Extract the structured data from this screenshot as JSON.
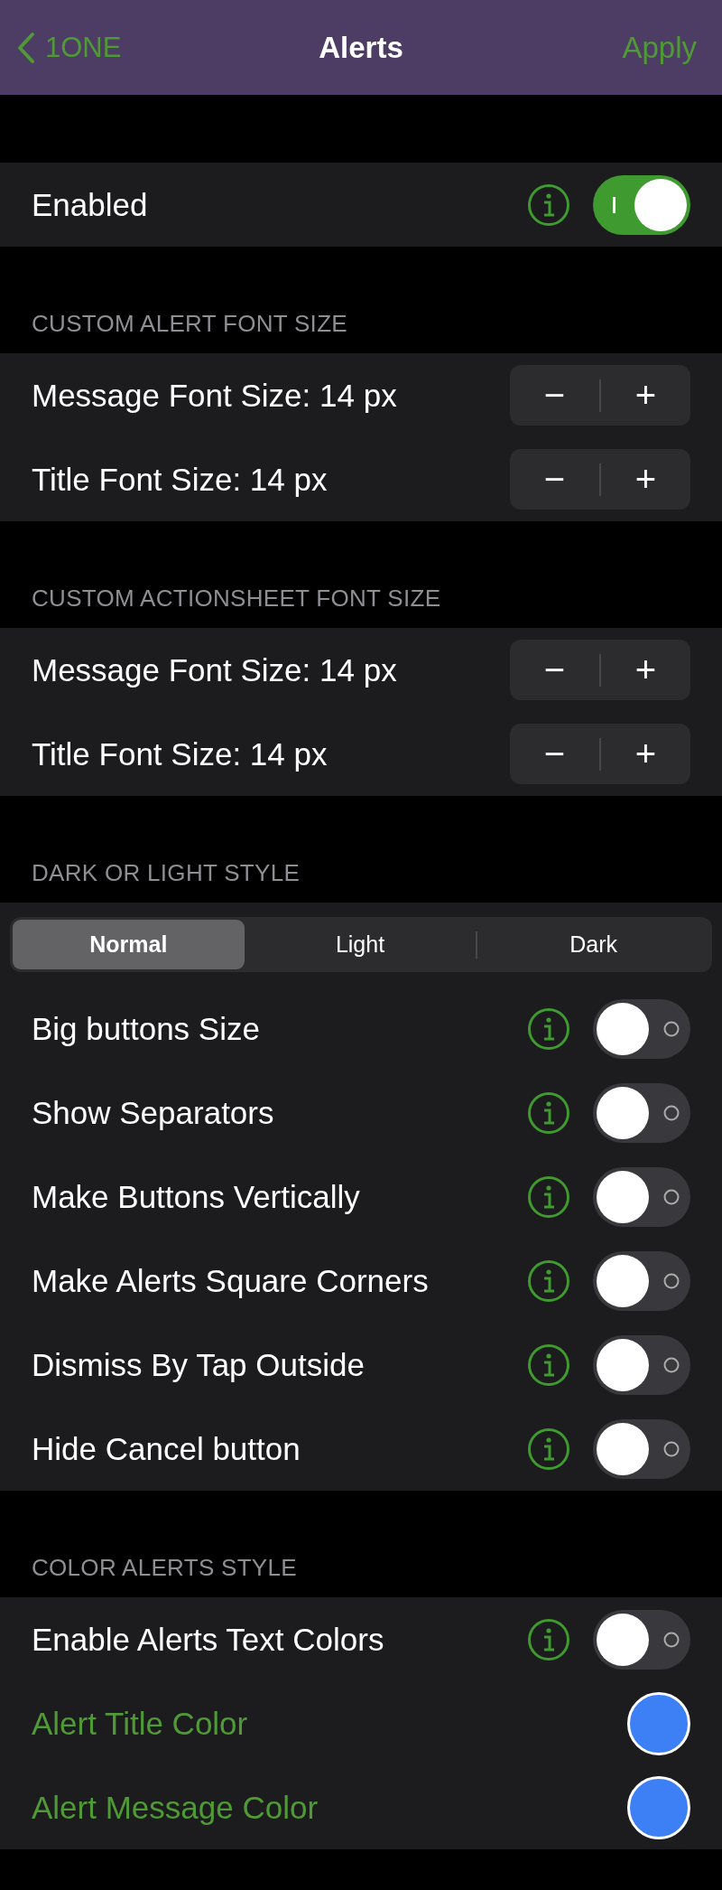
{
  "nav": {
    "back_label": "1ONE",
    "title": "Alerts",
    "action": "Apply"
  },
  "sections": [
    {
      "rows": [
        {
          "kind": "toggle",
          "label": "Enabled",
          "on": true
        }
      ]
    },
    {
      "header": "CUSTOM ALERT FONT SIZE",
      "rows": [
        {
          "kind": "stepper",
          "label": "Message Font Size: 14 px",
          "minus": "−",
          "plus": "+"
        },
        {
          "kind": "stepper",
          "label": "Title Font Size: 14 px",
          "minus": "−",
          "plus": "+"
        }
      ]
    },
    {
      "header": "CUSTOM ACTIONSHEET FONT SIZE",
      "rows": [
        {
          "kind": "stepper",
          "label": "Message Font Size: 14 px",
          "minus": "−",
          "plus": "+"
        },
        {
          "kind": "stepper",
          "label": "Title Font Size: 14 px",
          "minus": "−",
          "plus": "+"
        }
      ]
    },
    {
      "header": "DARK OR LIGHT STYLE",
      "rows": [
        {
          "kind": "segmented",
          "segments": [
            {
              "label": "Normal",
              "selected": true
            },
            {
              "label": "Light",
              "selected": false
            },
            {
              "label": "Dark",
              "selected": false
            }
          ]
        },
        {
          "kind": "toggle",
          "label": "Big buttons Size",
          "on": false
        },
        {
          "kind": "toggle",
          "label": "Show Separators",
          "on": false
        },
        {
          "kind": "toggle",
          "label": "Make Buttons Vertically",
          "on": false
        },
        {
          "kind": "toggle",
          "label": "Make Alerts Square Corners",
          "on": false
        },
        {
          "kind": "toggle",
          "label": "Dismiss By Tap Outside",
          "on": false
        },
        {
          "kind": "toggle",
          "label": "Hide Cancel button",
          "on": false
        }
      ]
    },
    {
      "header": "COLOR ALERTS STYLE",
      "rows": [
        {
          "kind": "toggle",
          "label": "Enable Alerts Text Colors",
          "on": false
        },
        {
          "kind": "color",
          "label": "Alert Title Color",
          "color": "#3d7ff5"
        },
        {
          "kind": "color",
          "label": "Alert Message Color",
          "color": "#3d7ff5"
        }
      ]
    }
  ]
}
